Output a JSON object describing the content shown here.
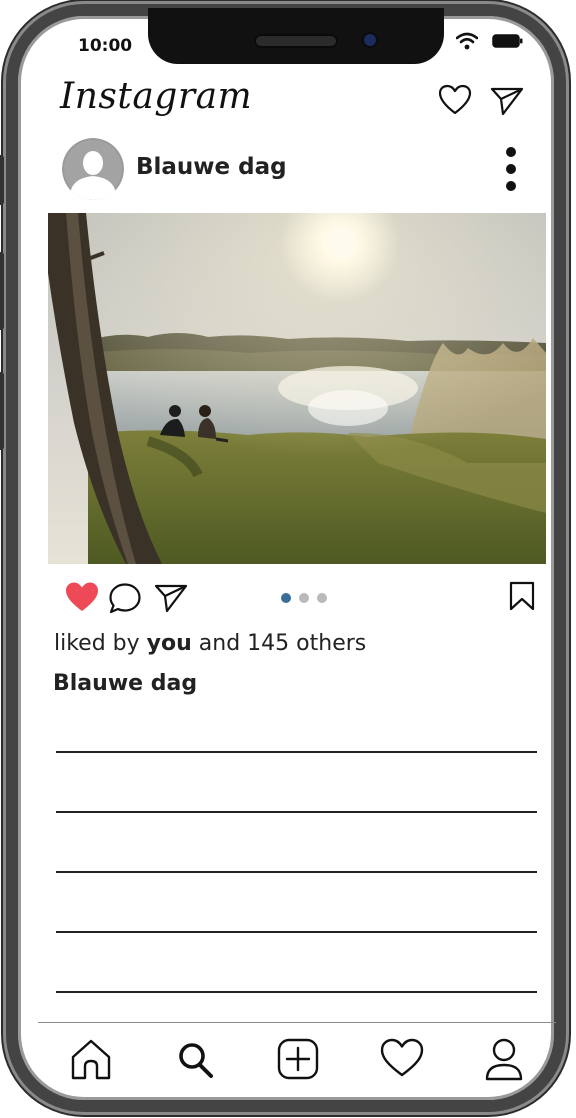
{
  "status_bar": {
    "time": "10:00",
    "wifi_icon": "wifi-icon",
    "battery_icon": "battery-icon"
  },
  "header": {
    "logo_text": "Instagram",
    "icons": [
      "heart-icon",
      "send-icon"
    ]
  },
  "post": {
    "username": "Blauwe dag",
    "avatar_icon": "user-silhouette-icon",
    "menu_icon": "more-vertical-icon",
    "liked": true,
    "like_color": "#ed4956",
    "carousel": {
      "total": 3,
      "active": 1
    },
    "likes_prefix": "liked by",
    "likes_bold": "you",
    "likes_suffix": "and 145 others",
    "caption_username": "Blauwe dag",
    "caption_line_count": 5
  },
  "bottom_nav": {
    "items": [
      "home-icon",
      "search-icon",
      "add-post-icon",
      "activity-heart-icon",
      "profile-icon"
    ]
  },
  "colors": {
    "text": "#222222",
    "carousel_active": "#3a6e9a",
    "carousel_inactive": "#b9b9b9"
  }
}
